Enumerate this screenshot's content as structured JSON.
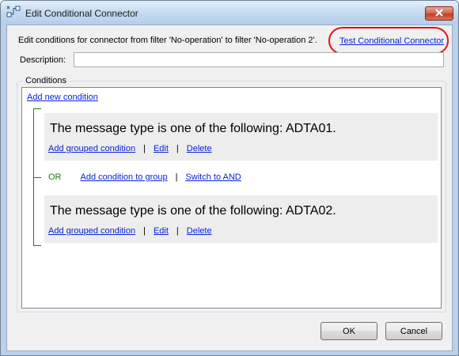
{
  "window": {
    "title": "Edit Conditional Connector",
    "title_icon": "connector-icon",
    "close_icon": "close-icon"
  },
  "header": {
    "info_text": "Edit conditions for connector from filter 'No-operation' to filter 'No-operation 2'.",
    "test_link": "Test Conditional Connector",
    "highlight_color": "#e1121a"
  },
  "description": {
    "label": "Description:",
    "value": ""
  },
  "conditions": {
    "group_label": "Conditions",
    "add_new": "Add new condition",
    "items": [
      {
        "title": "The message type is one of the following: ADTA01.",
        "add_grouped": "Add grouped condition",
        "edit": "Edit",
        "delete": "Delete"
      },
      {
        "title": "The message type is one of the following: ADTA02.",
        "add_grouped": "Add grouped condition",
        "edit": "Edit",
        "delete": "Delete"
      }
    ],
    "or_row": {
      "operator": "OR",
      "add_to_group": "Add condition to group",
      "switch": "Switch to AND"
    },
    "separator": "|",
    "bracket_color": "#1e7c12"
  },
  "buttons": {
    "ok": "OK",
    "cancel": "Cancel"
  }
}
